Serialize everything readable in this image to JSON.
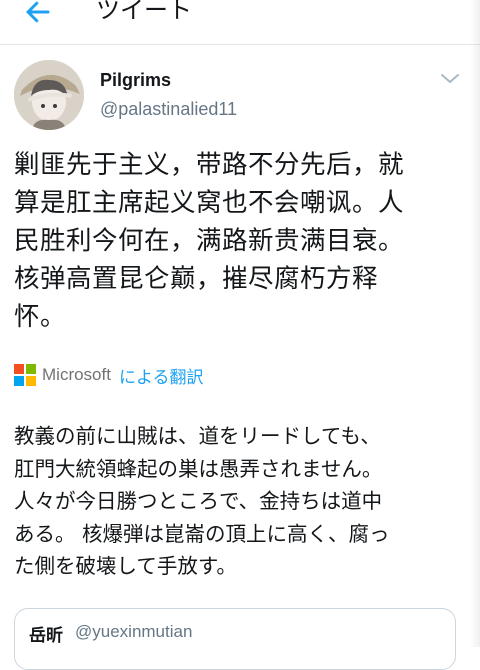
{
  "header": {
    "title": "ツイート",
    "back_icon": "arrow-left-icon"
  },
  "colors": {
    "accent": "#1da1f2",
    "text": "#14171a",
    "secondary_text": "#657786",
    "border": "#e1e8ed",
    "ms_red": "#f25022",
    "ms_green": "#7fba00",
    "ms_blue": "#00a4ef",
    "ms_yellow": "#ffb900"
  },
  "tweet": {
    "author_name": "Pilgrims",
    "author_handle": "@palastinalied11",
    "caret_icon": "chevron-down-icon",
    "text": "剿匪先于主义，带路不分先后，就\n算是肛主席起义窝也不会嘲讽。人\n民胜利今何在，满路新贵满目衰。\n核弹高置昆仑巅，摧尽腐朽方释\n怀。",
    "translation": {
      "provider": "Microsoft",
      "label": "による翻訳",
      "text": "教義の前に山賊は、道をリードしても、\n肛門大統領蜂起の巣は愚弄されません。\n人々が今日勝つところで、金持ちは道中\nある。 核爆弾は崑崙の頂上に高く、腐っ\nた側を破壊して手放す。"
    }
  },
  "quoted_tweet": {
    "author_name": "岳昕",
    "author_handle": "@yuexinmutian"
  }
}
